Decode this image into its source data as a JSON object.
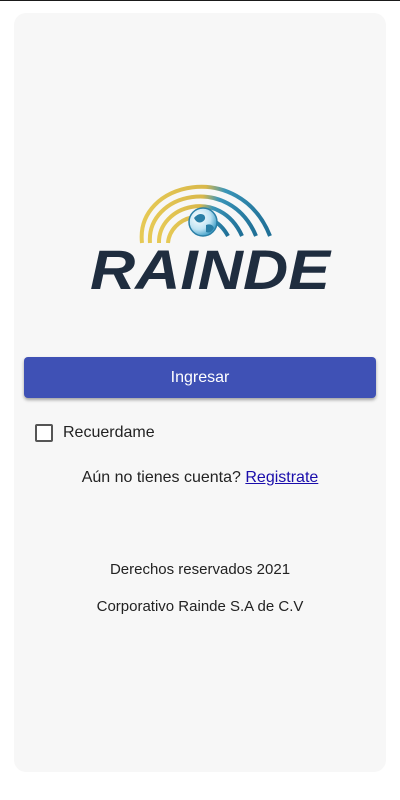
{
  "logo": {
    "text": "RAINDE",
    "icon": "globe-icon"
  },
  "login": {
    "button_label": "Ingresar"
  },
  "remember": {
    "label": "Recuerdame",
    "checked": false
  },
  "register": {
    "prompt": "Aún no tienes cuenta?",
    "link_label": "Registrate"
  },
  "footer": {
    "rights": "Derechos reservados 2021",
    "company": "Corporativo Rainde S.A de C.V"
  },
  "colors": {
    "primary": "#3f51b5",
    "logo_navy": "#1f2d3f",
    "logo_gold": "#e3c24a",
    "logo_blue": "#2c88b0",
    "link": "#1a0dab",
    "card_bg": "#f7f7f7"
  }
}
